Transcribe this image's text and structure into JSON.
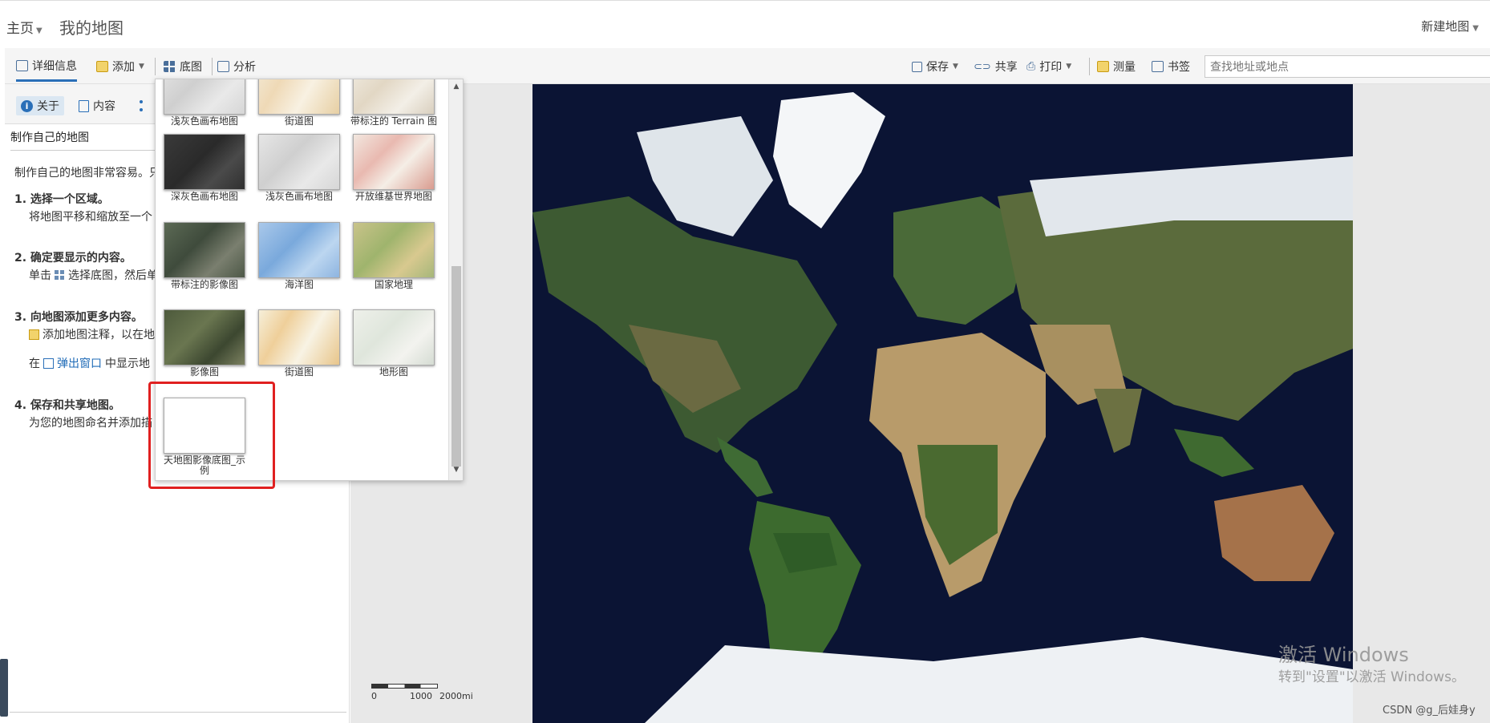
{
  "header": {
    "home_label": "主页",
    "map_title": "我的地图",
    "new_map_label": "新建地图"
  },
  "toolbar": {
    "details": "详细信息",
    "add": "添加",
    "basemap": "底图",
    "analysis": "分析",
    "save": "保存",
    "share": "共享",
    "print": "打印",
    "measure": "测量",
    "bookmarks": "书签",
    "search_placeholder": "查找地址或地点"
  },
  "left_panel": {
    "tabs": {
      "about": "关于",
      "content": "内容"
    },
    "heading": "制作自己的地图",
    "intro": "制作自己的地图非常容易。只",
    "steps": [
      {
        "title": "1. 选择一个区域。",
        "text": "将地图平移和缩放至一个"
      },
      {
        "title": "2. 确定要显示的内容。",
        "text_pre": "单击",
        "text_post": "选择底图，然后单"
      },
      {
        "title": "3. 向地图添加更多内容。",
        "text": "添加地图注释，以在地",
        "popup_pre": "在",
        "popup_link": "弹出窗口",
        "popup_post": "中显示地"
      },
      {
        "title": "4. 保存和共享地图。",
        "text": "为您的地图命名并添加描"
      }
    ]
  },
  "basemap_gallery": {
    "items": [
      {
        "label": "浅灰色画布地图",
        "style": "t-lightgray"
      },
      {
        "label": "街道图",
        "style": "t-street"
      },
      {
        "label": "带标注的 Terrain 图",
        "style": "t-terrain"
      },
      {
        "label": "深灰色画布地图",
        "style": "t-darkgray"
      },
      {
        "label": "浅灰色画布地图",
        "style": "t-lightgray"
      },
      {
        "label": "开放维基世界地图",
        "style": "t-osm"
      },
      {
        "label": "带标注的影像图",
        "style": "t-imagery-lab"
      },
      {
        "label": "海洋图",
        "style": "t-ocean"
      },
      {
        "label": "国家地理",
        "style": "t-natgeo"
      },
      {
        "label": "影像图",
        "style": "t-imagery"
      },
      {
        "label": "街道图",
        "style": "t-street2"
      },
      {
        "label": "地形图",
        "style": "t-topo"
      },
      {
        "label": "天地图影像底图_示例",
        "style": "t-blank"
      }
    ]
  },
  "map": {
    "scale_labels": [
      "0",
      "1000",
      "2000mi"
    ],
    "watermark_line1": "激活 Windows",
    "watermark_line2": "转到\"设置\"以激活 Windows。",
    "csdn": "CSDN @g_后娃身y"
  },
  "colors": {
    "accent": "#2a6fb8",
    "highlight": "#e02020",
    "ocean": "#0a1230"
  }
}
